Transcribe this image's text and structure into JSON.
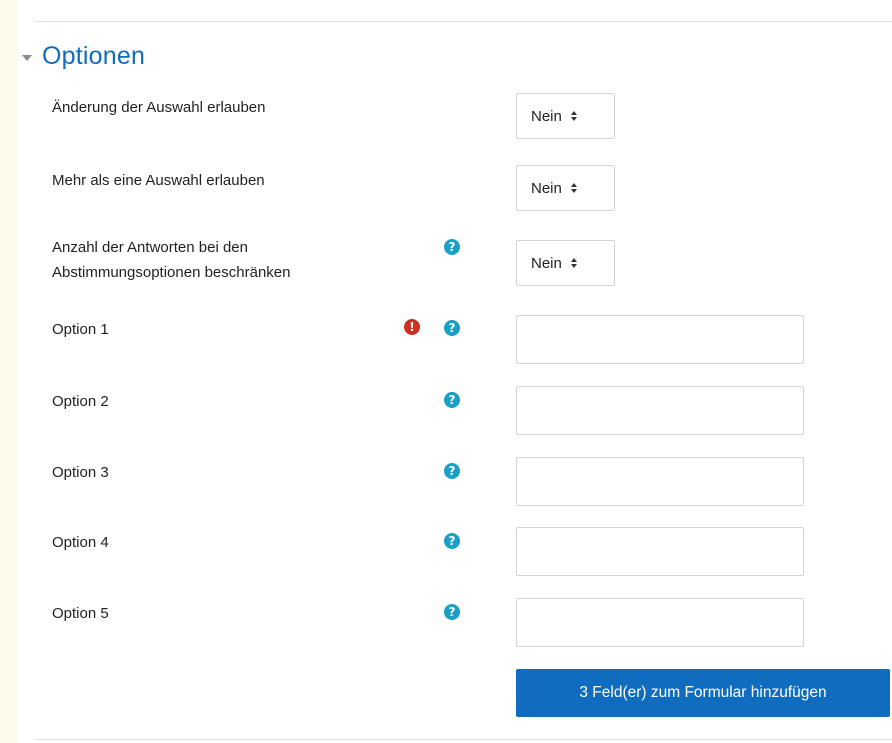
{
  "section": {
    "title": "Optionen"
  },
  "settings": [
    {
      "label": "Änderung der Auswahl erlauben",
      "value": "Nein"
    },
    {
      "label": "Mehr als eine Auswahl erlauben",
      "value": "Nein"
    },
    {
      "label_line1": "Anzahl der Antworten bei den",
      "label_line2": "Abstimmungsoptionen beschränken",
      "value": "Nein"
    }
  ],
  "options": [
    {
      "label": "Option 1",
      "value": "",
      "error": true
    },
    {
      "label": "Option 2",
      "value": ""
    },
    {
      "label": "Option 3",
      "value": ""
    },
    {
      "label": "Option 4",
      "value": ""
    },
    {
      "label": "Option 5",
      "value": ""
    }
  ],
  "icons": {
    "help": "?",
    "error": "!"
  },
  "add_button_label": "3 Feld(er) zum Formular hinzufügen",
  "colors": {
    "accent": "#0f6cbf",
    "help": "#1aa0c6",
    "error": "#ca3120",
    "page_background": "#fefaea"
  }
}
